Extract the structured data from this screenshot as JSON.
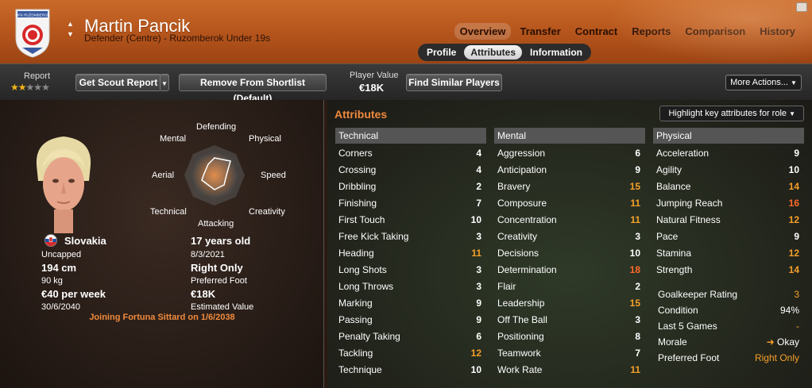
{
  "header": {
    "club_badge_text": "MFK RUŽOMBEROK",
    "player_name": "Martin Pancik",
    "player_sub": "Defender (Centre) - Ruzomberok Under 19s",
    "tabs": [
      "Overview",
      "Transfer",
      "Contract",
      "Reports",
      "Comparison",
      "History"
    ],
    "active_tab": "Overview",
    "sub_tabs": [
      "Profile",
      "Attributes",
      "Information"
    ],
    "active_sub_tab": "Attributes"
  },
  "actionbar": {
    "report_label": "Report",
    "stars_filled": 2,
    "stars_total": 5,
    "get_scout_report": "Get Scout Report",
    "remove_shortlist": "Remove From Shortlist (Default)",
    "player_value_label": "Player Value",
    "player_value": "€18K",
    "find_similar": "Find Similar Players",
    "more_actions": "More Actions..."
  },
  "profile": {
    "radar_labels": {
      "defending": "Defending",
      "physical": "Physical",
      "speed": "Speed",
      "creativity": "Creativity",
      "attacking": "Attacking",
      "technical": "Technical",
      "aerial": "Aerial",
      "mental": "Mental"
    },
    "nationality": "Slovakia",
    "caps": "Uncapped",
    "height": "194 cm",
    "weight": "90 kg",
    "wage": "€40 per week",
    "contract_end": "30/6/2040",
    "age": "17 years old",
    "dob": "8/3/2021",
    "foot": "Right Only",
    "foot_label": "Preferred Foot",
    "est_value": "€18K",
    "est_value_label": "Estimated Value",
    "joining": "Joining Fortuna Sittard on 1/6/2038"
  },
  "attributes": {
    "title": "Attributes",
    "highlight_button": "Highlight key attributes for role",
    "technical": {
      "header": "Technical",
      "rows": [
        {
          "name": "Corners",
          "value": "4"
        },
        {
          "name": "Crossing",
          "value": "4"
        },
        {
          "name": "Dribbling",
          "value": "2"
        },
        {
          "name": "Finishing",
          "value": "7"
        },
        {
          "name": "First Touch",
          "value": "10"
        },
        {
          "name": "Free Kick Taking",
          "value": "3"
        },
        {
          "name": "Heading",
          "value": "11"
        },
        {
          "name": "Long Shots",
          "value": "3"
        },
        {
          "name": "Long Throws",
          "value": "3"
        },
        {
          "name": "Marking",
          "value": "9"
        },
        {
          "name": "Passing",
          "value": "9"
        },
        {
          "name": "Penalty Taking",
          "value": "6"
        },
        {
          "name": "Tackling",
          "value": "12"
        },
        {
          "name": "Technique",
          "value": "10"
        }
      ]
    },
    "mental": {
      "header": "Mental",
      "rows": [
        {
          "name": "Aggression",
          "value": "6"
        },
        {
          "name": "Anticipation",
          "value": "9"
        },
        {
          "name": "Bravery",
          "value": "15"
        },
        {
          "name": "Composure",
          "value": "11"
        },
        {
          "name": "Concentration",
          "value": "11"
        },
        {
          "name": "Creativity",
          "value": "3"
        },
        {
          "name": "Decisions",
          "value": "10"
        },
        {
          "name": "Determination",
          "value": "18"
        },
        {
          "name": "Flair",
          "value": "2"
        },
        {
          "name": "Leadership",
          "value": "15"
        },
        {
          "name": "Off The Ball",
          "value": "3"
        },
        {
          "name": "Positioning",
          "value": "8"
        },
        {
          "name": "Teamwork",
          "value": "7"
        },
        {
          "name": "Work Rate",
          "value": "11"
        }
      ]
    },
    "physical": {
      "header": "Physical",
      "rows": [
        {
          "name": "Acceleration",
          "value": "9"
        },
        {
          "name": "Agility",
          "value": "10"
        },
        {
          "name": "Balance",
          "value": "14"
        },
        {
          "name": "Jumping Reach",
          "value": "16"
        },
        {
          "name": "Natural Fitness",
          "value": "12"
        },
        {
          "name": "Pace",
          "value": "9"
        },
        {
          "name": "Stamina",
          "value": "12"
        },
        {
          "name": "Strength",
          "value": "14"
        }
      ]
    },
    "summary": [
      {
        "name": "Goalkeeper Rating",
        "value": "3"
      },
      {
        "name": "Condition",
        "value": "94%"
      },
      {
        "name": "Last 5 Games",
        "value": "-"
      },
      {
        "name": "Morale",
        "value": "Okay"
      },
      {
        "name": "Preferred Foot",
        "value": "Right Only"
      }
    ]
  },
  "colors": {
    "orange_accent": "#f08a3c",
    "value_orange": "#f5a02a",
    "value_red": "#ff6a2a"
  }
}
